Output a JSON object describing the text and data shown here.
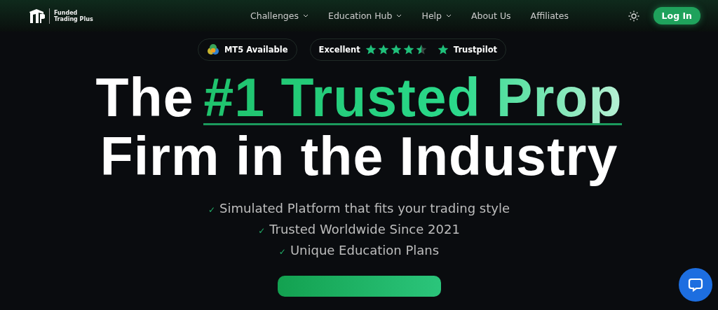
{
  "brand": {
    "name_line_1": "Funded",
    "name_line_2": "Trading Plus"
  },
  "nav": [
    {
      "label": "Challenges",
      "dropdown": true
    },
    {
      "label": "Education Hub",
      "dropdown": true
    },
    {
      "label": "Help",
      "dropdown": true
    },
    {
      "label": "About Us",
      "dropdown": false
    },
    {
      "label": "Affiliates",
      "dropdown": false
    }
  ],
  "login_button": "Log In",
  "badges": {
    "platform": "MT5 Available",
    "rating_label": "Excellent",
    "stars": 4.5,
    "review_site": "Trustpilot"
  },
  "headline": {
    "lead": "The",
    "highlight": "#1 Trusted Prop",
    "line_2": "Firm in the Industry"
  },
  "features": [
    {
      "check": "✓",
      "text": "Simulated Platform that fits your trading style"
    },
    {
      "check": "✓",
      "text": "Trusted Worldwide Since 2021"
    },
    {
      "check": "✓",
      "text": "Unique Education Plans"
    }
  ]
}
